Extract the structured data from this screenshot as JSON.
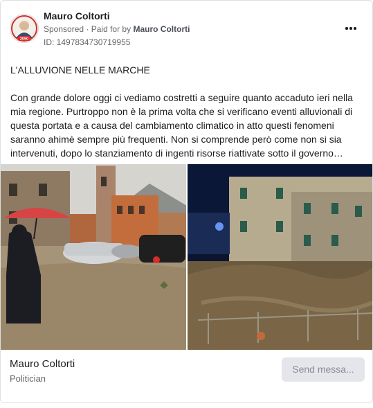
{
  "advertiser": {
    "name": "Mauro Coltorti",
    "sponsored_label": "Sponsored",
    "paid_for_label": "Paid for by",
    "payer": "Mauro Coltorti",
    "ad_id": "ID: 1497834730719955",
    "avatar_badge": "2050"
  },
  "post": {
    "headline": "L'ALLUVIONE NELLE MARCHE",
    "paragraph": [
      "Con grande dolore oggi ci vediamo costretti a seguire quanto accaduto ieri nella",
      "mia regione. Purtroppo non è la prima volta che si verificano eventi alluvionali di",
      "questa portata e a causa del cambiamento climatico in atto questi fenomeni",
      "saranno ahimè sempre più frequenti. Non si comprende però come non si sia",
      "intervenuti, dopo lo stanziamento di ingenti risorse riattivate sotto il governo…"
    ]
  },
  "footer": {
    "page_name": "Mauro Coltorti",
    "category": "Politician",
    "cta_label": "Send messa..."
  },
  "icons": {
    "more": "more-options-icon"
  },
  "colors": {
    "secondary_text": "#65676b",
    "button_bg": "#e4e6eb",
    "badge_red": "#d32f2f",
    "umbrella_red": "#d64545"
  }
}
